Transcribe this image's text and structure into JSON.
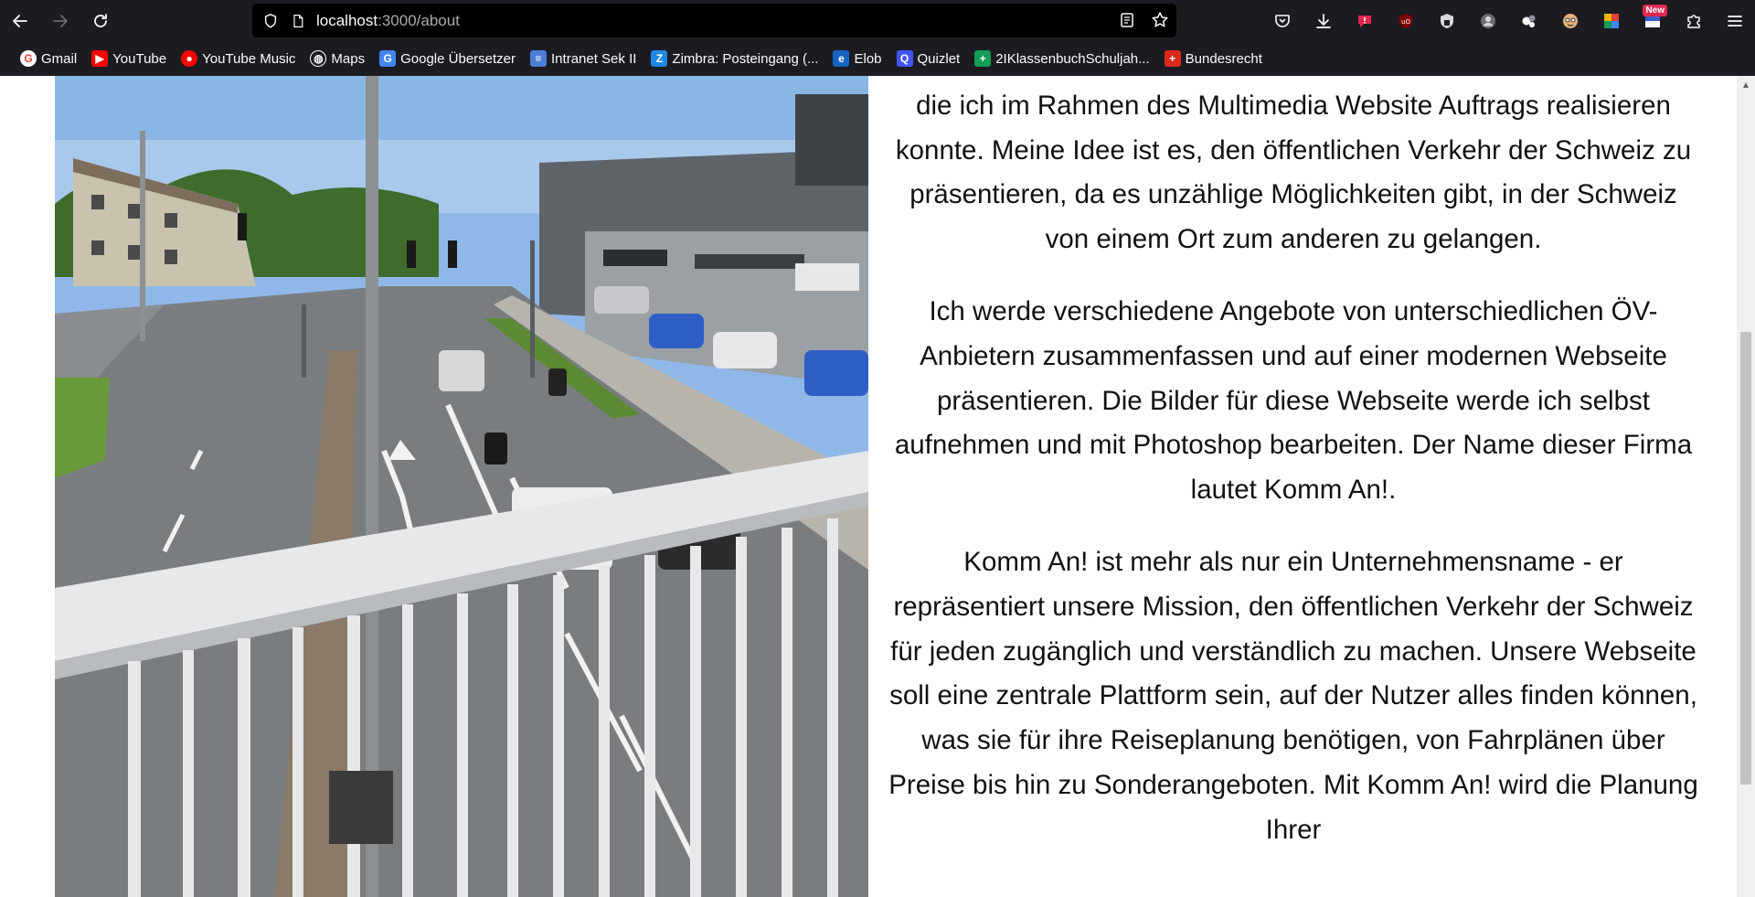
{
  "browser": {
    "url_host": "localhost",
    "url_path": ":3000/about",
    "colors": {
      "toolbar": "#1c1b22",
      "urlbar": "#000000"
    }
  },
  "bookmarks": [
    {
      "label": "Gmail",
      "icon": "gmail-icon",
      "color": "#ea4335"
    },
    {
      "label": "YouTube",
      "icon": "youtube-icon",
      "color": "#ff0000"
    },
    {
      "label": "YouTube Music",
      "icon": "youtube-music-icon",
      "color": "#ff0000"
    },
    {
      "label": "Maps",
      "icon": "globe-icon",
      "color": "#1c1b22"
    },
    {
      "label": "Google Übersetzer",
      "icon": "translate-icon",
      "color": "#4285f4"
    },
    {
      "label": "Intranet Sek II",
      "icon": "document-icon",
      "color": "#4a7fd6"
    },
    {
      "label": "Zimbra: Posteingang (...",
      "icon": "zimbra-icon",
      "color": "#1e88e5"
    },
    {
      "label": "Elob",
      "icon": "elob-icon",
      "color": "#1565c0"
    },
    {
      "label": "Quizlet",
      "icon": "quizlet-icon",
      "color": "#4255ff"
    },
    {
      "label": "2IKlassenbuchSchuljah...",
      "icon": "sheets-icon",
      "color": "#0f9d58"
    },
    {
      "label": "Bundesrecht",
      "icon": "swiss-flag-icon",
      "color": "#da291c"
    }
  ],
  "extensions": {
    "new_badge": "New"
  },
  "about": {
    "paragraphs": [
      "In diesem Abschnitt möchte ich meine Idee für die Firma vorstellen, die ich im Rahmen des Multimedia Website Auftrags realisieren konnte. Meine Idee ist es, den öffentlichen Verkehr der Schweiz zu präsentieren, da es unzählige Möglichkeiten gibt, in der Schweiz von einem Ort zum anderen zu gelangen.",
      "Ich werde verschiedene Angebote von unterschiedlichen ÖV-Anbietern zusammenfassen und auf einer modernen Webseite präsentieren. Die Bilder für diese Webseite werde ich selbst aufnehmen und mit Photoshop bearbeiten. Der Name dieser Firma lautet Komm An!.",
      "Komm An! ist mehr als nur ein Unternehmensname - er repräsentiert unsere Mission, den öffentlichen Verkehr der Schweiz für jeden zugänglich und verständlich zu machen. Unsere Webseite soll eine zentrale Plattform sein, auf der Nutzer alles finden können, was sie für ihre Reiseplanung benötigen, von Fahrplänen über Preise bis hin zu Sonderangeboten. Mit Komm An! wird die Planung Ihrer"
    ]
  }
}
